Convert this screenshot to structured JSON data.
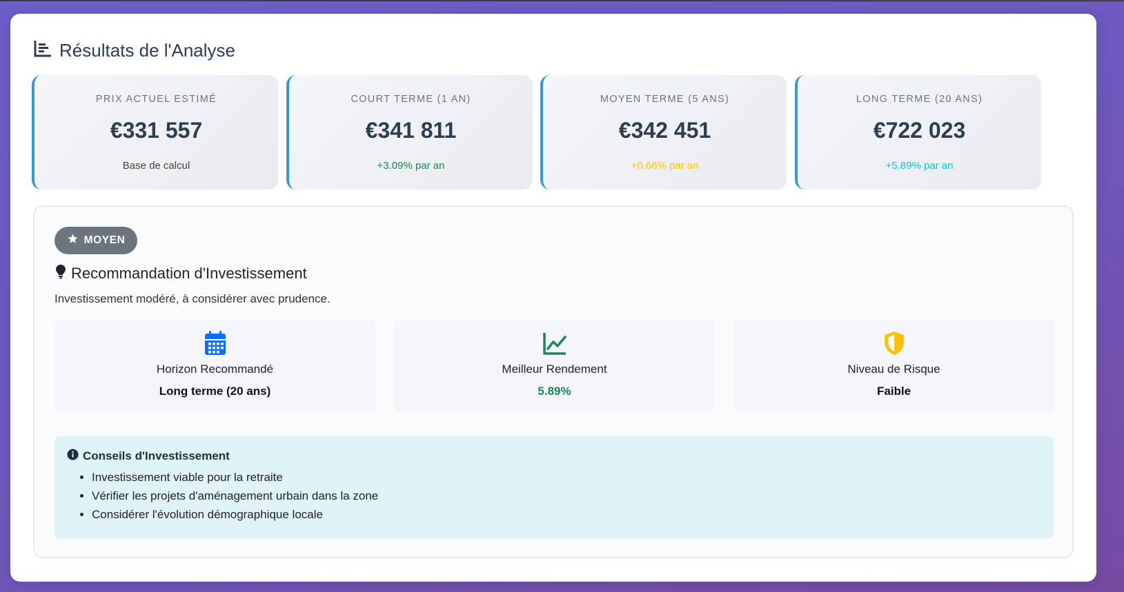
{
  "section": {
    "title": "Résultats de l'Analyse",
    "icon": "chart-bar-icon"
  },
  "metrics": [
    {
      "label": "Prix actuel estimé",
      "value": "€331 557",
      "sub": "Base de calcul",
      "sub_color": "#444444"
    },
    {
      "label": "Court terme (1 an)",
      "value": "€341 811",
      "sub": "+3.09% par an",
      "sub_color": "#198754"
    },
    {
      "label": "Moyen terme (5 ans)",
      "value": "€342 451",
      "sub": "+0.66% par an",
      "sub_color": "#ffc107"
    },
    {
      "label": "Long terme (20 ans)",
      "value": "€722 023",
      "sub": "+5.89% par an",
      "sub_color": "#17c1d8"
    }
  ],
  "recommendation": {
    "badge": "MOYEN",
    "badge_icon": "star-icon",
    "title": "Recommandation d'Investissement",
    "title_icon": "lightbulb-icon",
    "description": "Investissement modéré, à considérer avec prudence.",
    "cards": [
      {
        "icon": "calendar-icon",
        "icon_color": "#0d6efd",
        "label": "Horizon Recommandé",
        "value": "Long terme (20 ans)",
        "value_color": "#111111"
      },
      {
        "icon": "chart-line-icon",
        "icon_color": "#198754",
        "label": "Meilleur Rendement",
        "value": "5.89%",
        "value_color": "#198754"
      },
      {
        "icon": "shield-icon",
        "icon_color": "#ffc107",
        "label": "Niveau de Risque",
        "value": "Faible",
        "value_color": "#111111"
      }
    ],
    "advice": {
      "title": "Conseils d'Investissement",
      "icon": "info-circle-icon",
      "items": [
        "Investissement viable pour la retraite",
        "Vérifier les projets d'aménagement urbain dans la zone",
        "Considérer l'évolution démographique locale"
      ]
    }
  },
  "colors": {
    "accent": "#3498db",
    "badge_bg": "#6c757d",
    "advice_bg": "#e0f4f8"
  }
}
